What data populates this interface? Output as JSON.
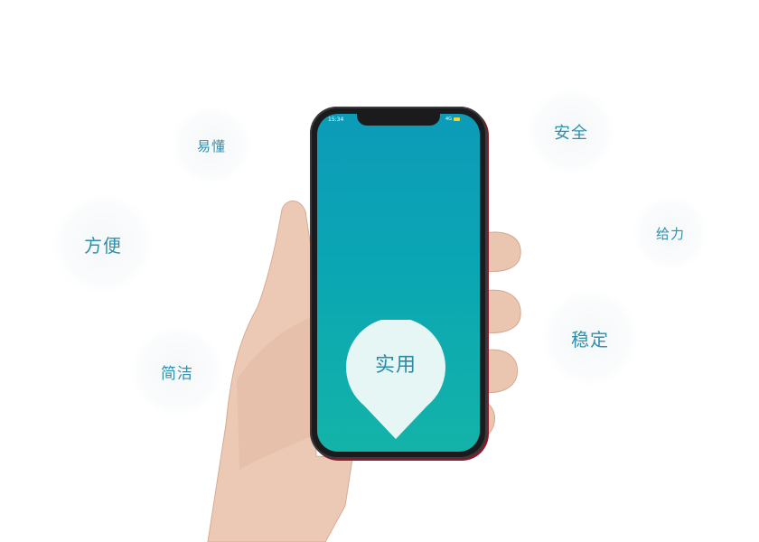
{
  "bubbles": {
    "yidong": "易懂",
    "fangbian": "方便",
    "jianjie": "简洁",
    "anquan": "安全",
    "geili": "给力",
    "wending": "稳定"
  },
  "phone": {
    "status_time": "15:34",
    "status_network": "4G",
    "center_label": "实用"
  }
}
